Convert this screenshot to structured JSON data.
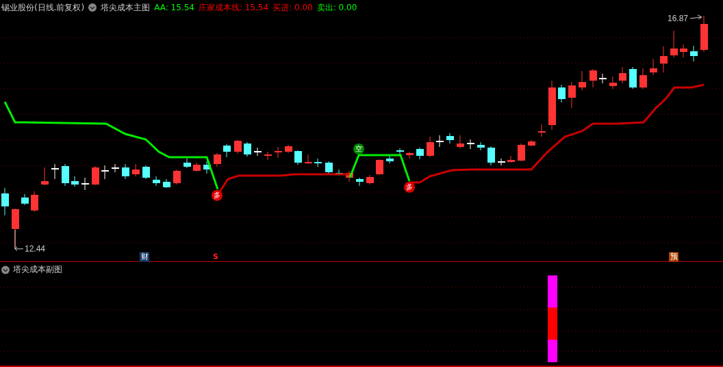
{
  "header": {
    "stock_title": "锡业股份(日线.前复权)",
    "indicator_name": "塔尖成本主图",
    "readings": [
      {
        "label": "AA:",
        "value": "15.54",
        "color": "#00ff00"
      },
      {
        "label": "庄家成本线:",
        "value": "15.54",
        "color": "#ff0000"
      },
      {
        "label": "买进:",
        "value": "0.00",
        "color": "#ff0000"
      },
      {
        "label": "卖出:",
        "value": "0.00",
        "color": "#00ff00"
      }
    ]
  },
  "price_labels": {
    "high": "16.87",
    "low": "12.44"
  },
  "signals": [
    {
      "text": "多",
      "kind": "buy"
    },
    {
      "text": "空",
      "kind": "sell"
    },
    {
      "text": "多",
      "kind": "buy"
    }
  ],
  "events": [
    {
      "text": "财",
      "kind": "finance"
    },
    {
      "text": "S",
      "kind": "dividend"
    },
    {
      "text": "预",
      "kind": "forecast"
    }
  ],
  "sub_pane": {
    "title": "塔尖成本副图"
  }
}
